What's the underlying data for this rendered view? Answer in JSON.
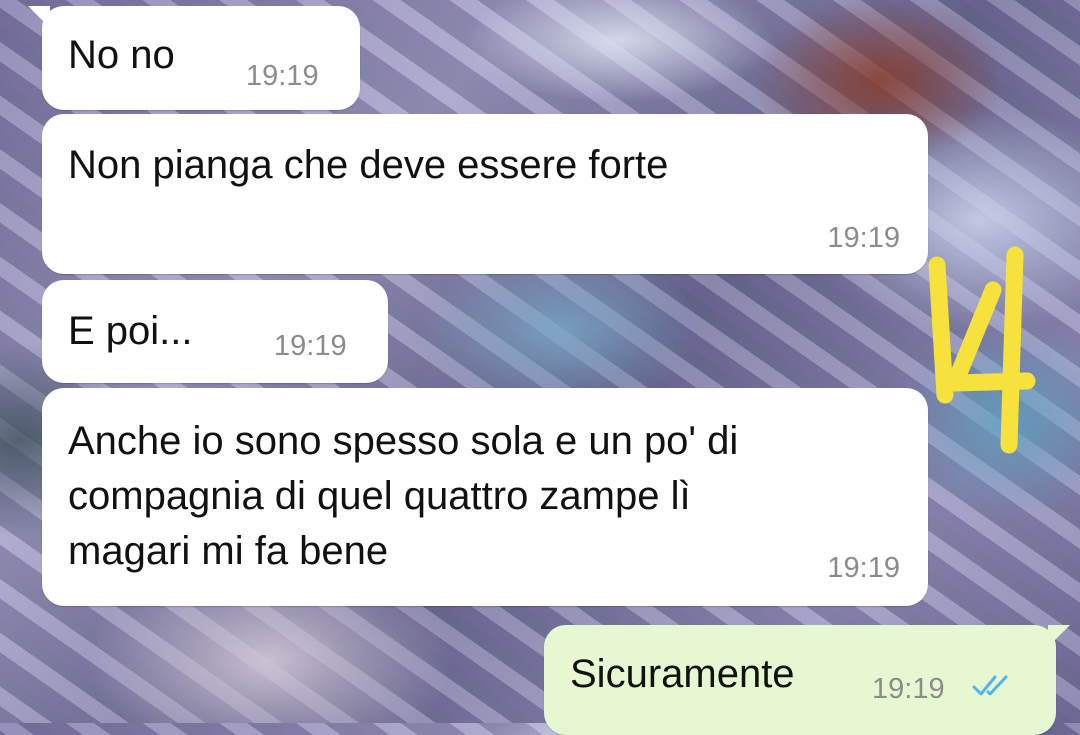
{
  "chat": {
    "messages": [
      {
        "direction": "incoming",
        "text": "No no",
        "time": "19:19"
      },
      {
        "direction": "incoming",
        "text": "Non pianga che deve essere forte",
        "time": "19:19"
      },
      {
        "direction": "incoming",
        "text": "E poi...",
        "time": "19:19"
      },
      {
        "direction": "incoming",
        "lines": [
          "Anche io sono spesso sola e un po' di",
          "compagnia di quel quattro zampe lì",
          "magari mi fa bene"
        ],
        "time": "19:19"
      },
      {
        "direction": "outgoing",
        "text": "Sicuramente",
        "time": "19:19",
        "status": "read",
        "status_icon": "double-check-icon"
      }
    ]
  },
  "annotation": {
    "text": "14",
    "color": "#f6e13d"
  },
  "colors": {
    "incoming_bubble": "#ffffff",
    "outgoing_bubble": "#e6f8d2",
    "timestamp": "#8c8c8c",
    "read_ticks": "#4fb6ec"
  }
}
